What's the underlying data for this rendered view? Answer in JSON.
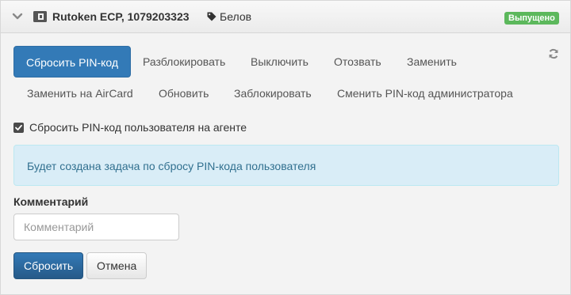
{
  "header": {
    "title": "Rutoken ECP, 1079203323",
    "owner": "Белов",
    "status": "Выпущено",
    "status_color": "#5cb85c"
  },
  "actions": {
    "row1": [
      "Сбросить PIN-код",
      "Разблокировать",
      "Выключить",
      "Отозвать",
      "Заменить"
    ],
    "row2": [
      "Заменить на AirCard",
      "Обновить",
      "Заблокировать",
      "Сменить PIN-код администратора"
    ],
    "active": "Сбросить PIN-код"
  },
  "form": {
    "checkbox_label": "Сбросить PIN-код пользователя на агенте",
    "checkbox_checked": true,
    "alert_text": "Будет создана задача по сбросу PIN-кода пользователя",
    "comment_label": "Комментарий",
    "comment_placeholder": "Комментарий",
    "comment_value": "",
    "submit_label": "Сбросить",
    "cancel_label": "Отмена"
  },
  "icons": {
    "collapse": "chevron-down-icon",
    "token": "token-device-icon",
    "owner": "tag-icon",
    "refresh": "refresh-icon"
  },
  "colors": {
    "primary": "#337ab7",
    "alert_bg": "#d9edf7",
    "alert_text": "#31708f"
  }
}
